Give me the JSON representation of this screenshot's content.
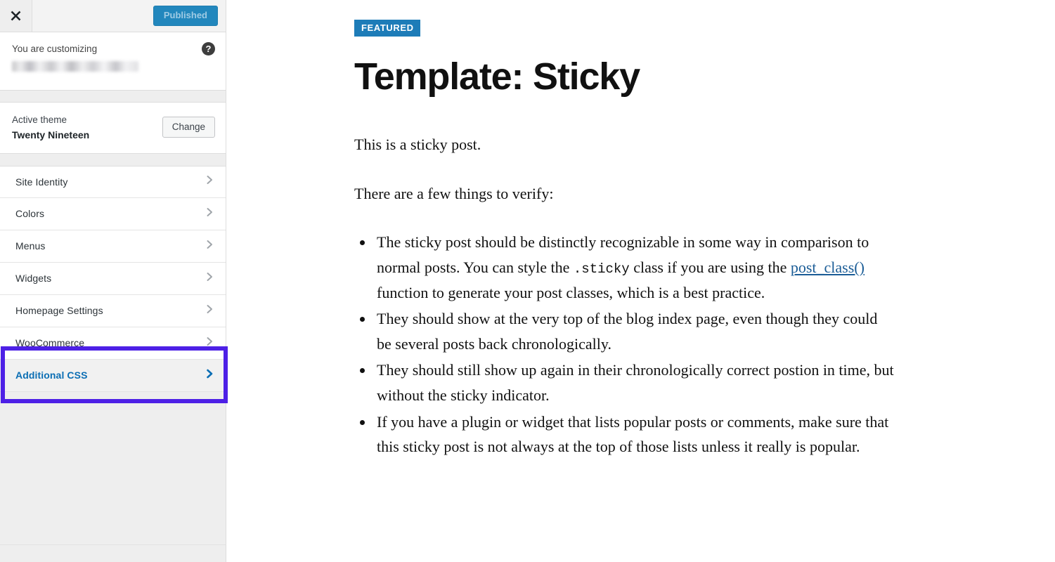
{
  "customizer": {
    "header": {
      "close_icon": "close-icon",
      "publish_label": "Published"
    },
    "customizing": {
      "label": "You are customizing",
      "site_name": "",
      "help_icon": "help-icon"
    },
    "theme": {
      "caption": "Active theme",
      "name": "Twenty Nineteen",
      "change_label": "Change"
    },
    "sections": [
      {
        "label": "Site Identity",
        "active": false
      },
      {
        "label": "Colors",
        "active": false
      },
      {
        "label": "Menus",
        "active": false
      },
      {
        "label": "Widgets",
        "active": false
      },
      {
        "label": "Homepage Settings",
        "active": false
      },
      {
        "label": "WooCommerce",
        "active": false
      },
      {
        "label": "Additional CSS",
        "active": true
      }
    ],
    "highlight_color": "#4d20e6"
  },
  "preview": {
    "badge": "FEATURED",
    "title": "Template: Sticky",
    "intro_1": "This is a sticky post.",
    "intro_2": "There are a few things to verify:",
    "bullets": [
      {
        "part1": "The sticky post should be distinctly recognizable in some way in comparison to normal posts. You can style the ",
        "code": ".sticky",
        "part2": " class if you are using the ",
        "link": "post_class()",
        "part3": " function to generate your post classes, which is a best practice."
      },
      {
        "text": "They should show at the very top of the blog index page, even though they could be several posts back chronologically."
      },
      {
        "text": "They should still show up again in their chronologically correct postion in time, but without the sticky indicator."
      },
      {
        "text": "If you have a plugin or widget that lists popular posts or comments, make sure that this sticky post is not always at the top of those lists unless it really is popular."
      }
    ],
    "badge_color": "#1d7cb8",
    "link_color": "#1a5c96"
  }
}
